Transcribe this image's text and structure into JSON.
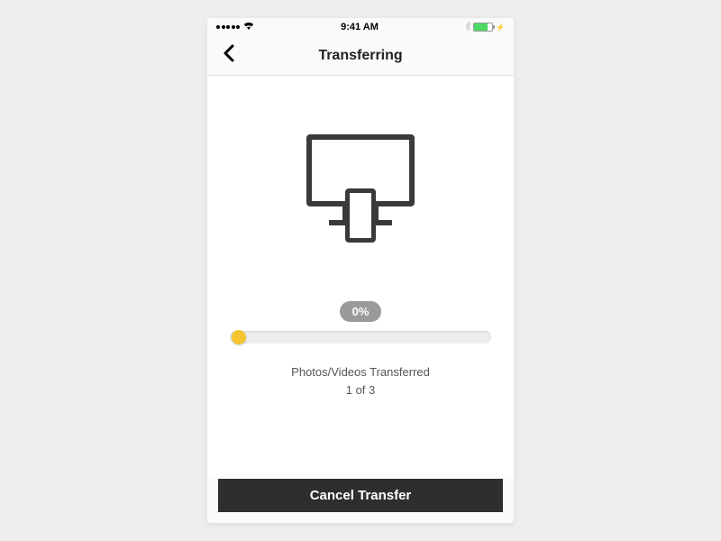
{
  "statusbar": {
    "time": "9:41 AM"
  },
  "nav": {
    "title": "Transferring"
  },
  "progress": {
    "percent_label": "0%",
    "percent_value": 0
  },
  "status": {
    "line1": "Photos/Videos Transferred",
    "line2": "1 of 3"
  },
  "actions": {
    "cancel_label": "Cancel Transfer"
  },
  "icons": {
    "back": "chevron-left-icon",
    "wifi": "wifi-icon",
    "bluetooth": "bluetooth-icon",
    "battery": "battery-icon",
    "transfer": "monitor-phone-transfer-icon"
  },
  "colors": {
    "accent": "#f4c431",
    "dark": "#2e2e2e",
    "battery_fill": "#4cd964"
  }
}
